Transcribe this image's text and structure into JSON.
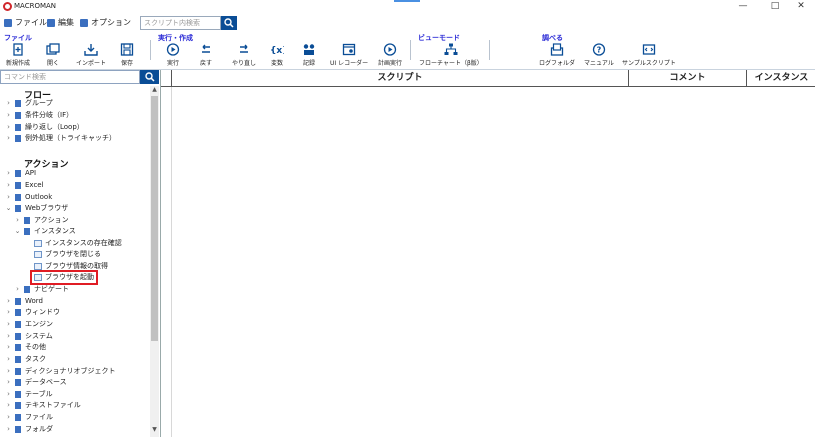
{
  "window": {
    "title": "MACROMAN",
    "minimize": "—",
    "maximize": "□",
    "close": "✕"
  },
  "menu": {
    "items": [
      "ファイル",
      "編集",
      "オプション"
    ],
    "search_placeholder": "スクリプト内検索"
  },
  "ribbon": {
    "groups": {
      "file": "ファイル",
      "run_create": "実行・作成",
      "view_mode": "ビューモード",
      "lookup": "調べる"
    },
    "buttons": {
      "new": "新規作成",
      "open": "開く",
      "import": "インポート",
      "save": "保存",
      "run": "実行",
      "undo": "戻す",
      "redo": "やり直し",
      "variable": "変数",
      "record": "記録",
      "ui_recorder": "UI レコーダー",
      "schedule": "計画実行",
      "flowchart": "フローチャート（β版）",
      "log_folder": "ログフォルダ",
      "manual": "マニュアル",
      "sample_script": "サンプルスクリプト"
    }
  },
  "sidebar": {
    "search_placeholder": "コマンド検索",
    "flow_title": "フロー",
    "flow_items": [
      "グループ",
      "条件分岐（IF）",
      "繰り返し（Loop）",
      "例外処理（トライキャッチ）"
    ],
    "action_title": "アクション",
    "action_items_top": [
      "API",
      "Excel",
      "Outlook",
      "Webブラウザ"
    ],
    "web_children": [
      "アクション",
      "インスタンス"
    ],
    "instance_children": [
      "インスタンスの存在確認",
      "ブラウザを閉じる",
      "ブラウザ情報の取得",
      "ブラウザを起動"
    ],
    "web_after": [
      "ナビゲート"
    ],
    "action_items_bottom": [
      "Word",
      "ウィンドウ",
      "エンジン",
      "システム",
      "その他",
      "タスク",
      "ディクショナリオブジェクト",
      "データベース",
      "テーブル",
      "テキストファイル",
      "ファイル",
      "フォルダ"
    ]
  },
  "grid": {
    "columns": [
      "スクリプト",
      "コメント",
      "インスタンス"
    ]
  },
  "colors": {
    "accent": "#0a4d96",
    "group_label": "#2b2bd6",
    "highlight": "#e01c24"
  }
}
